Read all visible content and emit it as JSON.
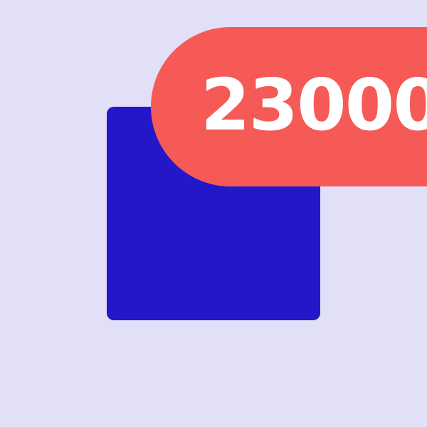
{
  "icon": {
    "name": "app-tile",
    "color": "#2318c9"
  },
  "badge": {
    "count": "23000",
    "color": "#f55a57",
    "text_color": "#ffffff"
  },
  "background_color": "#e2e0f6"
}
